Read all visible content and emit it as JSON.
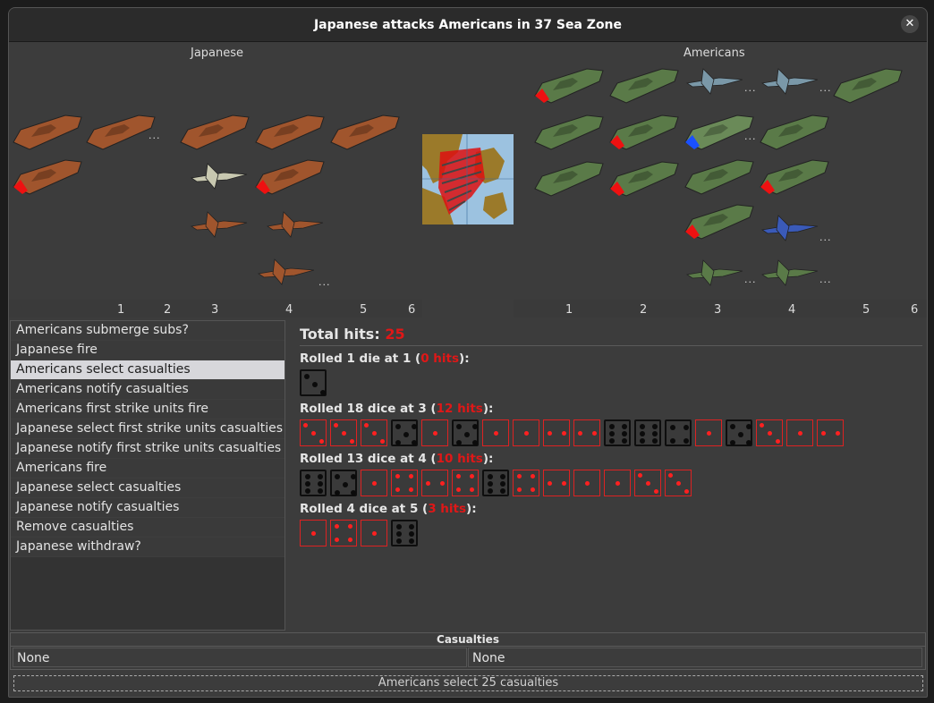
{
  "window": {
    "title": "Japanese attacks Americans in 37 Sea Zone",
    "close_label": "✕"
  },
  "sides": {
    "left": "Japanese",
    "right": "Americans"
  },
  "colors": {
    "hit": "#ff2020",
    "japanese_unit": "#a0552d",
    "american_unit": "#5a7a48"
  },
  "columns_left": [
    "1",
    "2",
    "3",
    "4",
    "5",
    "6"
  ],
  "columns_right": [
    "1",
    "2",
    "3",
    "4",
    "5",
    "6"
  ],
  "steps": [
    "Americans submerge subs?",
    "Japanese fire",
    "Americans select casualties",
    "Americans notify casualties",
    "Americans first strike units fire",
    "Japanese select first strike units casualties",
    "Japanese notify first strike units casualties",
    "Americans fire",
    "Japanese select casualties",
    "Japanese notify casualties",
    "Remove casualties",
    "Japanese withdraw?"
  ],
  "selected_step": 2,
  "results": {
    "total_label": "Total hits:",
    "total_value": "25",
    "rolls": [
      {
        "prefix": "Rolled 1 die at 1 (",
        "hits": "0 hits",
        "suffix": "):",
        "dice": [
          3
        ],
        "hit": [
          false
        ]
      },
      {
        "prefix": "Rolled 18 dice at 3 (",
        "hits": "12 hits",
        "suffix": "):",
        "dice": [
          3,
          3,
          3,
          5,
          1,
          5,
          1,
          1,
          2,
          2,
          6,
          6,
          4,
          1,
          5,
          3,
          1,
          2
        ],
        "hit": [
          true,
          true,
          true,
          false,
          true,
          false,
          true,
          true,
          true,
          true,
          false,
          false,
          false,
          true,
          false,
          true,
          true,
          true
        ]
      },
      {
        "prefix": "Rolled 13 dice at 4 (",
        "hits": "10 hits",
        "suffix": "):",
        "dice": [
          6,
          5,
          1,
          4,
          2,
          4,
          6,
          4,
          2,
          1,
          1,
          3,
          3
        ],
        "hit": [
          false,
          false,
          true,
          true,
          true,
          true,
          false,
          true,
          true,
          true,
          true,
          true,
          true
        ]
      },
      {
        "prefix": "Rolled 4 dice at 5 (",
        "hits": "3 hits",
        "suffix": "):",
        "dice": [
          1,
          4,
          1,
          6
        ],
        "hit": [
          true,
          true,
          true,
          false
        ]
      }
    ]
  },
  "casualties": {
    "title": "Casualties",
    "left": "None",
    "right": "None"
  },
  "status": "Americans select 25 casualties",
  "ellipsis": "..."
}
